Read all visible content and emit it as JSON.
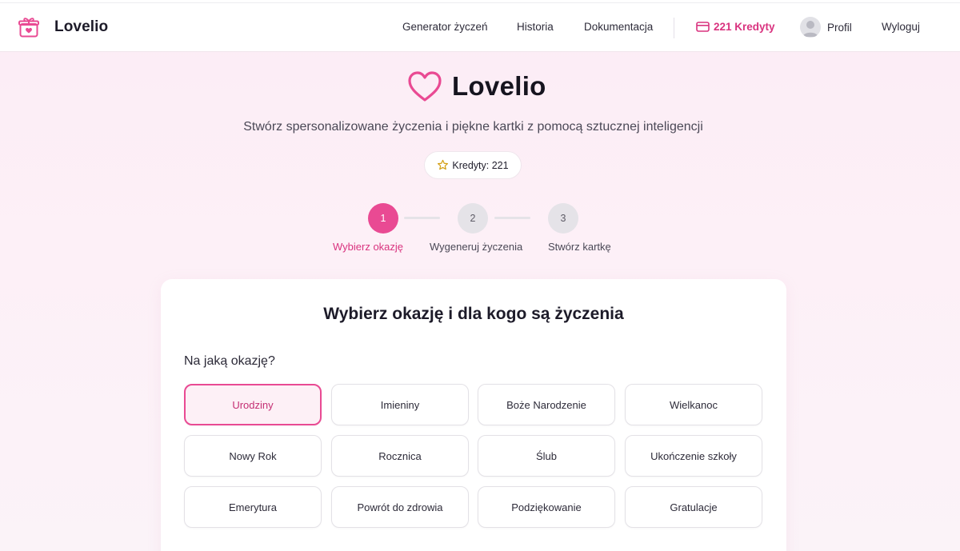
{
  "header": {
    "brand_name": "Lovelio",
    "nav": {
      "generator": "Generator życzeń",
      "history": "Historia",
      "docs": "Dokumentacja",
      "credits": "221 Kredyty",
      "profile": "Profil",
      "logout": "Wyloguj"
    }
  },
  "hero": {
    "title": "Lovelio",
    "subtitle": "Stwórz spersonalizowane życzenia i piękne kartki z pomocą sztucznej inteligencji",
    "credits_pill": "Kredyty: 221"
  },
  "steps": [
    {
      "number": "1",
      "label": "Wybierz okazję",
      "active": true
    },
    {
      "number": "2",
      "label": "Wygeneruj życzenia",
      "active": false
    },
    {
      "number": "3",
      "label": "Stwórz kartkę",
      "active": false
    }
  ],
  "panel": {
    "title": "Wybierz okazję i dla kogo są życzenia",
    "question": "Na jaką okazję?",
    "occasions": [
      {
        "label": "Urodziny",
        "selected": true
      },
      {
        "label": "Imieniny",
        "selected": false
      },
      {
        "label": "Boże Narodzenie",
        "selected": false
      },
      {
        "label": "Wielkanoc",
        "selected": false
      },
      {
        "label": "Nowy Rok",
        "selected": false
      },
      {
        "label": "Rocznica",
        "selected": false
      },
      {
        "label": "Ślub",
        "selected": false
      },
      {
        "label": "Ukończenie szkoły",
        "selected": false
      },
      {
        "label": "Emerytura",
        "selected": false
      },
      {
        "label": "Powrót do zdrowia",
        "selected": false
      },
      {
        "label": "Podziękowanie",
        "selected": false
      },
      {
        "label": "Gratulacje",
        "selected": false
      }
    ]
  },
  "colors": {
    "accent": "#e94a93",
    "accent_text": "#d9337f",
    "background": "#fcecf5"
  },
  "icons": {
    "brand": "gift-icon",
    "hero": "heart-icon",
    "credits": "credit-card-icon",
    "pill": "star-icon",
    "profile": "avatar-icon"
  }
}
